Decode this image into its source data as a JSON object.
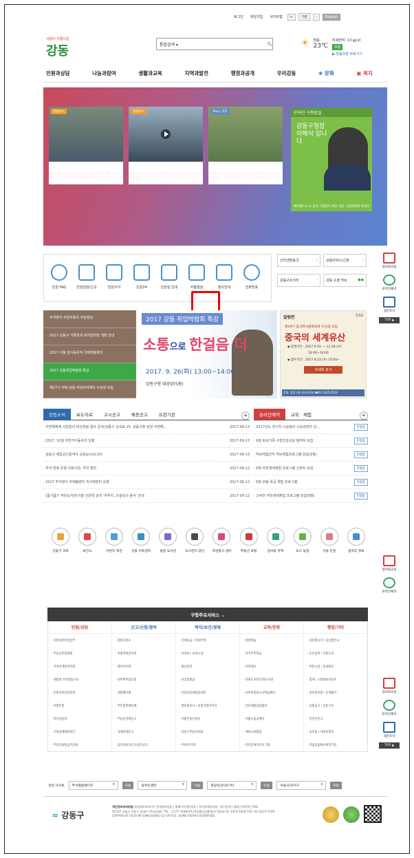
{
  "util": {
    "login": "로그인",
    "join": "회원가입",
    "sitemap": "사이트맵",
    "plus": "+",
    "base": "기본",
    "minus": "-",
    "english": "English"
  },
  "logo": {
    "slogan": "사람이 아름다운",
    "name": "강동"
  },
  "search": {
    "scope": "통합검색",
    "placeholder": ""
  },
  "weather": {
    "state": "맑음",
    "temp": "23℃",
    "dust": "미세먼지: 13 ㎍/㎥",
    "level": "보통",
    "link": "▶ 방동조망 바로가기"
  },
  "gnb": [
    "민원과상담",
    "나눔과참여",
    "생활과교육",
    "지역과발전",
    "행정과공개",
    "우리강동",
    "문화",
    "복지"
  ],
  "hero": {
    "cards": [
      {
        "tag": "강동뉴스",
        "title": "선선한 가을 주말은 이색 축제와 함께",
        "desc": "성동 디기온 가을 기폭과 좋길 수 있는 주말 축제를 소개해드립니다. 오는 9일 상일동신에서는 제5회 게내마을축제가 개최..."
      },
      {
        "tag": "강동뉴스",
        "title": "강동 · 광진구민이 한자리에! 광진교",
        "desc": "지난 26일 강동구 천호동에 위치한 광진교에서 '르자교를 통해 세워하는 전주자녀 감회를 모티브로 한 '광진교 페스티벌'이 개..."
      },
      {
        "tag": "Story 강동",
        "title": "아파트숲 속에서 펼쳐지는 신비한 생",
        "desc": "아파트숲을 가로지르는 고덕천, 미곡에서 특별한 수업이 이뤄진답니다. 자연환경해설사 선생님과 함께 하천에 사는 곤충 에 대..."
      }
    ],
    "chief": {
      "header": "온라인 구청장실",
      "text": "강동구청장 이해식 입니다",
      "links": [
        "매니페스토 & 공약",
        "구청장이 찍은 사진",
        "구청장에게 바란다"
      ]
    }
  },
  "quick": [
    "민원 FAQ",
    "민원상담/신고",
    "민원서식",
    "민원24",
    "민원실 안내",
    "자율점검",
    "청사안내",
    "전화번호"
  ],
  "quick_right": [
    {
      "label": "인터넷방송국",
      "arrow": "›"
    },
    {
      "label": "강동타비스/신청",
      "arrow": "›"
    },
    {
      "label": "강동구소식지",
      "arrow": "›"
    },
    {
      "label": "강동 소셜 허브",
      "arrow": ""
    }
  ],
  "side": [
    {
      "label": "정보화교실"
    },
    {
      "label": "온라인예약"
    },
    {
      "label": "설문조사"
    },
    {
      "label": "TOP ▲"
    }
  ],
  "news_list": [
    "· 추석맞이 귀성자동차 무상점검",
    "· 2017 강동구 기록관과 복지한마당 개최 안내",
    "· 2017 서울 암사동유적 국제학술회의",
    "· 2017 강동취업박람회 특강",
    "· 제27기 아파-강동 여성아카데미 수강생 모집"
  ],
  "banner": {
    "head": "2017 강동 취업박람회 특강",
    "big1": "소통",
    "big2": "으로 ",
    "big3": "한걸음 더",
    "date": "2017. 9. 26(화) 13:00~14:00",
    "place": "강동구청 대강당(5층)"
  },
  "alert": {
    "title": "알림판",
    "page": "7/12",
    "sub": "제24기 암사역사문화대학 수강생 모집",
    "big": "중국의 세계유산",
    "i1": "◆ 운영기간 : 2017.9.20. ~ 11.29.(수)",
    "i2": "14:00~16:00",
    "i3": "◆ 접수기간 : 2017.8.23.(수) 10:00~",
    "btn": "자세히 보기",
    "foot": "문의: 강동구청 선사유적과 ☎02-3425-6529"
  },
  "news": {
    "tabs": [
      "강동소식",
      "보도자료",
      "고시공고",
      "채용공고",
      "유관기관"
    ],
    "plus": "+",
    "rows": [
      {
        "t": "· 석면해체계 사업장의 비산측정 결과 공개(강동구 성내로 25, 강동구청 본관 석면해...",
        "d": "2017-09-13"
      },
      {
        "t": "· 2017. 10월 저전거이동수리 일정",
        "d": "2017-09-13"
      },
      {
        "t": "· 강동구 재업공인중개사 교육실시(9.20)",
        "d": "2017-09-13"
      },
      {
        "t": "· 추석 연휴 운영 의료기관, 약국 명단",
        "d": "2017-09-12"
      },
      {
        "t": "· 2017 추석맞이 자애불랜지 직거래장터 운영",
        "d": "2017-09-12"
      },
      {
        "t": "· (품기품기 작은도서관)가을 인문학 강의 '하루키, 소설속의 음악' 안내",
        "d": "2017-09-12"
      }
    ]
  },
  "reserve": {
    "tabs": [
      "온라인예약",
      "교육 · 체험"
    ],
    "plus": "+",
    "rows": [
      {
        "t": "· 2017년도 전기차 시승행사 시승희망자 선...",
        "s": "진행중"
      },
      {
        "t": "· 9월 토요가족 구장건강교실 참여자 모집",
        "s": "진행중"
      },
      {
        "t": "· 허브체험단지 허브체험프로그램 모집(9월)",
        "s": "진행중"
      },
      {
        "t": "· 9월 자연생태체험 프로그램 신청자 모집",
        "s": "진행중"
      },
      {
        "t": "· 9월 모탕 옥공 체험 프로그램",
        "s": "진행중"
      },
      {
        "t": "· 고덕천 하천생태체험 프로그램 모집(9월)",
        "s": "진행중"
      }
    ]
  },
  "orgs": [
    {
      "l": "강동구 의회",
      "c": "#e9a23b"
    },
    {
      "l": "보건소",
      "c": "#d94a4a"
    },
    {
      "l": "어린이 회관",
      "c": "#4aa0d9"
    },
    {
      "l": "강동 아트센터",
      "c": "#3a8fc9"
    },
    {
      "l": "통합 도서관",
      "c": "#7a6ad0"
    },
    {
      "l": "도시관리 공단",
      "c": "#4a4a4a"
    },
    {
      "l": "자원봉사 센터",
      "c": "#d94a7a"
    },
    {
      "l": "부동산 포털",
      "c": "#c93a3a"
    },
    {
      "l": "암사동 유적",
      "c": "#3aa07a"
    },
    {
      "l": "도시 농업",
      "c": "#6ab04a"
    },
    {
      "l": "이동 민원",
      "c": "#e07a8a"
    },
    {
      "l": "일자리 정보",
      "c": "#4a8ad9"
    }
  ],
  "services": {
    "title": "구청주요서비스",
    "cols": [
      {
        "h": "민원/상담",
        "c": "#d04040",
        "items": [
          "· 지방세인터넷납부",
          "· 부동산민원열람",
          "· 가족관계등록민원",
          "· 대법원 인터넷등기소",
          "· 민원처리관리운영",
          "· 여권민원",
          "· 복지상담실",
          "· 구청장에게바란다",
          "· 무인민원발급기안내"
        ]
      },
      {
        "h": "신고/신청/참여",
        "c": "#2e6bb0",
        "items": [
          "· 청원초청소",
          "· 주정차위반조회",
          "· 행사약신청",
          "· 숙박위주음신청",
          "· 대형폐기물",
          "· 주민참여예산제",
          "· 부동산거래신고",
          "· 규제의제신고",
          "· 공직자비리신고/공익신고"
        ]
      },
      {
        "h": "복지/보건/경제",
        "c": "#2e6bb0",
        "items": [
          "· 전세자금 / 임대주택",
          "· 보육료 / 보육시설",
          "· 출산장려",
          "· 보건증발급",
          "· 건강100세상담센터",
          "· 병의원약국 / 휴일지킴이약국",
          "· 서울부동산정보",
          "· 강동구부동산포털",
          "· 주택/주거복"
        ]
      },
      {
        "h": "교육/문화",
        "c": "#d04040",
        "items": [
          "· 평생학습",
          "· 자기주주학습",
          "· 저지체교",
          "· 학원도서관/전자도서관",
          "· 사이버업정교사학습센터",
          "· 진로체험상담협의",
          "· 서울시공공예약",
          "· 체육시설통합",
          "· 온라인예약프로그램"
        ]
      },
      {
        "h": "행정/기타",
        "c": "#d04040",
        "items": [
          "· 칭찬합니다 / 상상할건소",
          "· 도로굴착 / 지중도로",
          "· 버튼시장 / 동네정보",
          "· 통계 / 시청정보포인트",
          "· 일자리지원 / 인재뱅크",
          "· 입찰공고 / 강동구보",
          "· 안전신문고",
          "· 동호회 / 대표이밀라",
          "· 마을공동체사회적기업"
        ]
      }
    ]
  },
  "related": {
    "label": "· 관련 사이트",
    "selects": [
      "부서별홈페이지",
      "동주민센터",
      "희망의/관내/기타",
      "서울시/자치구"
    ],
    "go": "이동"
  },
  "footer": {
    "logo": "강동구",
    "l1": "개인정보처리방침",
    "l2": "영상정보처리기기 운영관리방침 | 홈페이지개인정보 | 청각장애인지원 | 청사안내 | 웹접근성정책 | RSS",
    "l3": "05397 서울시 강동구 성내로 25(성내동) TEL : 1577-1188(#120서울다산콜센터) 민원실 02 3425-5000 FAX: 02-3425-7209",
    "l4": "COPYRIGHT 2016 BY GANGDONG-GU OFFICE. SOME RIGHTS RESERVED"
  }
}
